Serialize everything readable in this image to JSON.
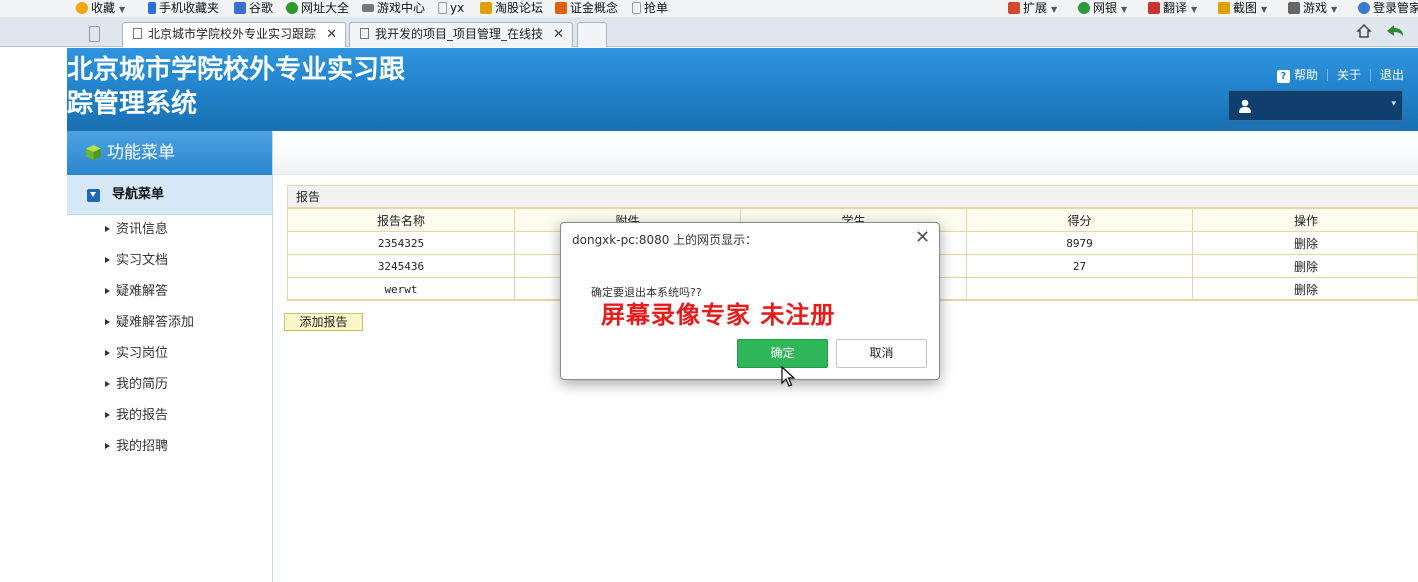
{
  "browser": {
    "bookmarks": [
      {
        "label": "收藏",
        "icon": "star-icon",
        "color": "#f0a800",
        "caret": true
      },
      {
        "label": "手机收藏夹",
        "icon": "phone-icon",
        "color": "#2a6fd6"
      },
      {
        "label": "谷歌",
        "icon": "google-icon",
        "color": "#3b6fd8"
      },
      {
        "label": "网址大全",
        "icon": "globe-icon",
        "color": "#2b9a2b"
      },
      {
        "label": "游戏中心",
        "icon": "gamepad-icon",
        "color": "#777777"
      },
      {
        "label": "yx",
        "icon": "page-icon",
        "color": "#999999"
      },
      {
        "label": "淘股论坛",
        "icon": "leaf-icon",
        "color": "#e0a000"
      },
      {
        "label": "证金概念",
        "icon": "flame-icon",
        "color": "#e06000"
      },
      {
        "label": "抢单",
        "icon": "page-icon",
        "color": "#999999"
      }
    ],
    "tools": [
      {
        "label": "扩展",
        "icon": "grid-icon",
        "color": "#d24a2a"
      },
      {
        "label": "网银",
        "icon": "yen-icon",
        "color": "#2a9a3a"
      },
      {
        "label": "翻译",
        "icon": "translate-icon",
        "color": "#c83232"
      },
      {
        "label": "截图",
        "icon": "scissors-icon",
        "color": "#e0a000"
      },
      {
        "label": "游戏",
        "icon": "gamepad-icon",
        "color": "#666666"
      },
      {
        "label": "登录管家",
        "icon": "key-icon",
        "color": "#3a7ad0"
      }
    ],
    "tabs": [
      {
        "label": "北京城市学院校外专业实习跟踪",
        "active": true
      },
      {
        "label": "我开发的项目_项目管理_在线技",
        "active": false
      }
    ]
  },
  "header": {
    "title": "北京城市学院校外专业实习跟踪管理系统",
    "help": "帮助",
    "about": "关于",
    "logout": "退出",
    "help_glyph": "?"
  },
  "sidebar": {
    "menu_title": "功能菜单",
    "nav_title": "导航菜单",
    "items": [
      "资讯信息",
      "实习文档",
      "疑难解答",
      "疑难解答添加",
      "实习岗位",
      "我的简历",
      "我的报告",
      "我的招聘"
    ]
  },
  "panel": {
    "title": "报告",
    "columns": [
      "报告名称",
      "附件",
      "学生",
      "得分",
      "操作"
    ],
    "rows": [
      [
        "2354325",
        "",
        "",
        "8979",
        "删除"
      ],
      [
        "3245436",
        "",
        "",
        "27",
        "删除"
      ],
      [
        "werwt",
        "",
        "",
        "",
        "删除"
      ]
    ],
    "add_button": "添加报告"
  },
  "dialog": {
    "title": "dongxk-pc:8080 上的网页显示：",
    "message": "确定要退出本系统吗??",
    "watermark": "屏幕录像专家  未注册",
    "ok": "确定",
    "cancel": "取消"
  },
  "colors": {
    "header_blue": "#1f7fc6",
    "ok_green": "#2eb659",
    "watermark_red": "#e51c1c",
    "table_border": "#e3d7a8"
  }
}
